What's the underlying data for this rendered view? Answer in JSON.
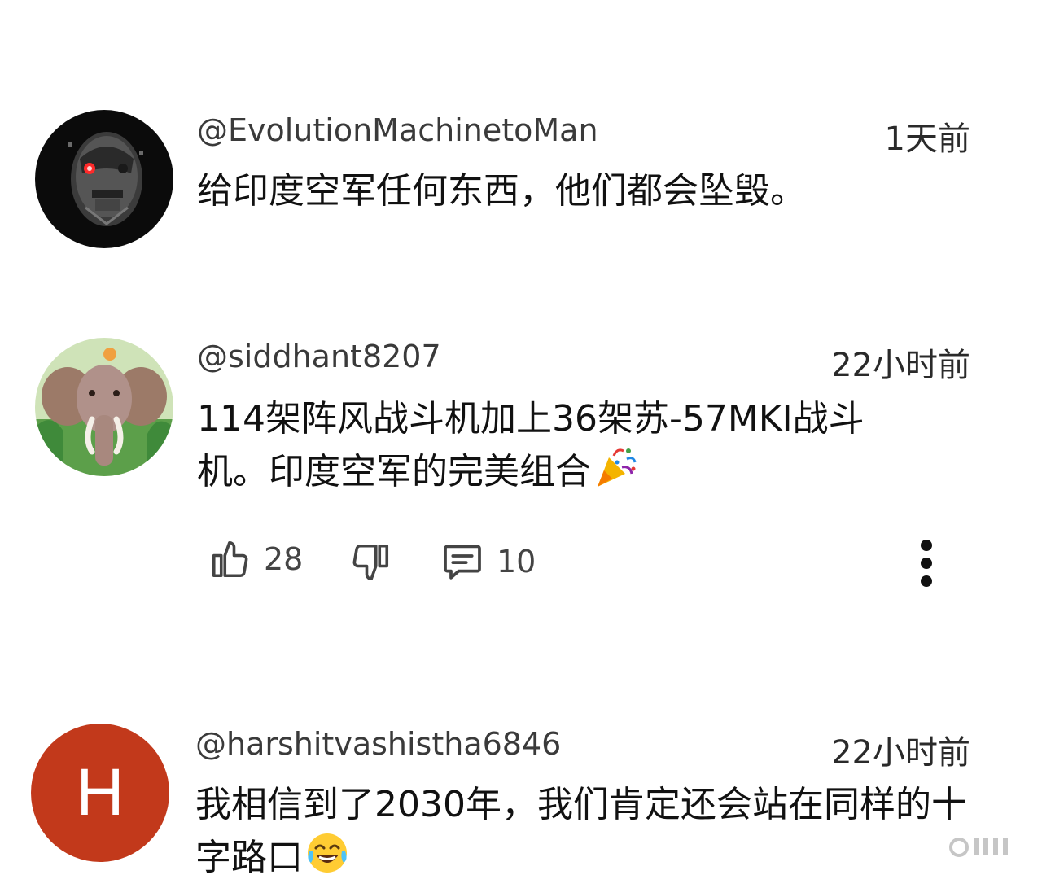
{
  "comments": [
    {
      "username": "@EvolutionMachinetoMan",
      "time": "1天前",
      "text": "给印度空军任何东西，他们都会坠毁。"
    },
    {
      "username": "@siddhant8207",
      "time": "22小时前",
      "text": "114架阵风战斗机加上36架苏-57MKI战斗机。印度空军的完美组合",
      "likes": "28",
      "replies": "10"
    },
    {
      "username": "@harshitvashistha6846",
      "time": "22小时前",
      "avatar_letter": "H",
      "text": "我相信到了2030年，我们肯定还会站在同样的十字路口"
    }
  ],
  "icons": {
    "like": "thumbs-up-icon",
    "dislike": "thumbs-down-icon",
    "reply": "comment-icon",
    "more": "more-vertical-icon",
    "party": "party-popper-emoji",
    "laugh": "tears-of-joy-emoji"
  },
  "colors": {
    "avatar_h": "#c2391b",
    "username": "#3a3a3a",
    "text": "#111111"
  }
}
